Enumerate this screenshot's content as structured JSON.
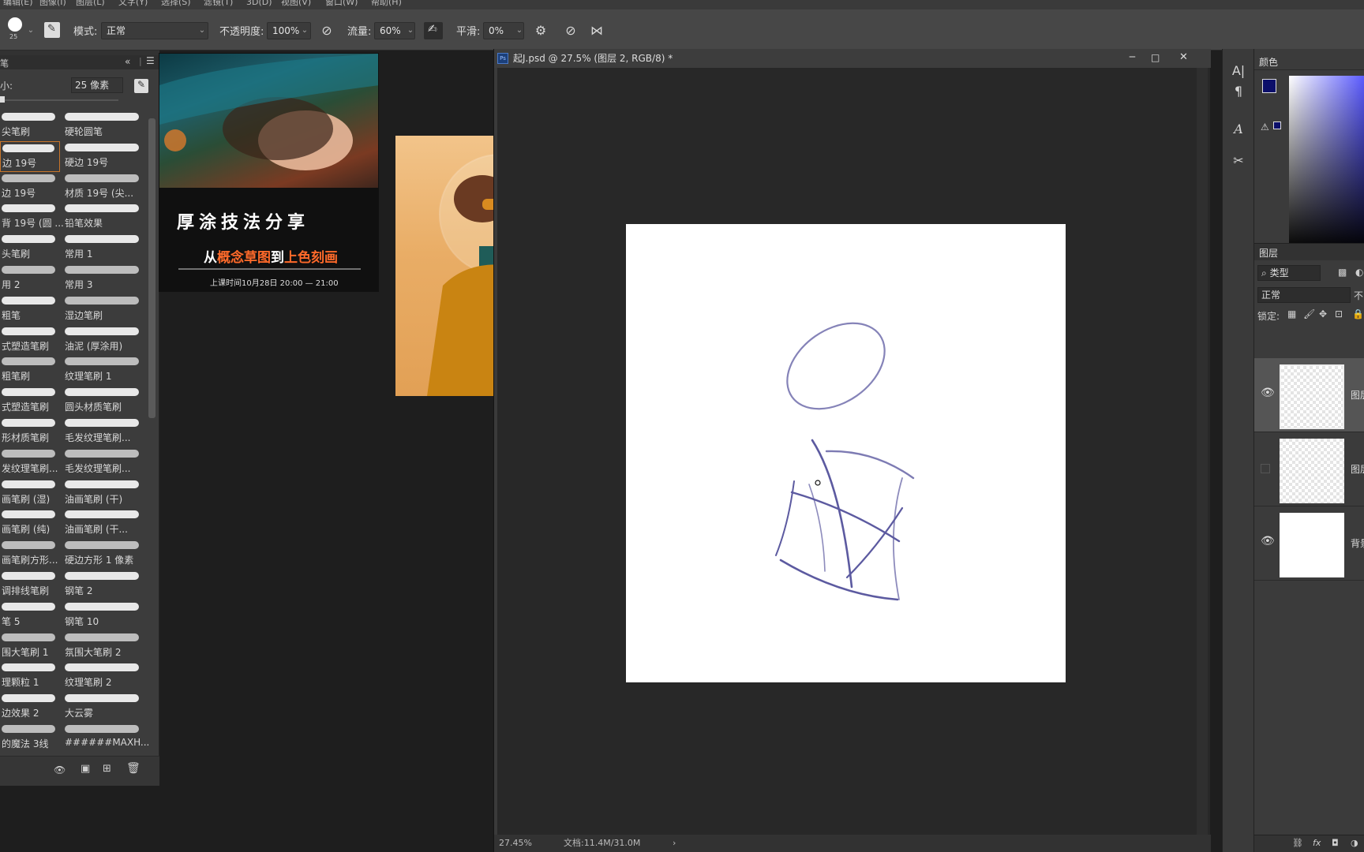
{
  "menu": [
    "编辑(E)",
    "图像(I)",
    "图层(L)",
    "文字(Y)",
    "选择(S)",
    "滤镜(T)",
    "3D(D)",
    "视图(V)",
    "窗口(W)",
    "帮助(H)"
  ],
  "options": {
    "brush_size": "25",
    "mode_label": "模式:",
    "mode_value": "正常",
    "opacity_label": "不透明度:",
    "opacity_value": "100%",
    "flow_label": "流量:",
    "flow_value": "60%",
    "smooth_label": "平滑:",
    "smooth_value": "0%"
  },
  "brush_panel": {
    "title": "笔",
    "size_label": "小:",
    "size_value": "25 像素",
    "brushes": [
      [
        "尖笔刷",
        "硬轮圆笔"
      ],
      [
        "边 19号",
        "硬边 19号"
      ],
      [
        "边 19号",
        "材质 19号 (尖..."
      ],
      [
        "背 19号 (圆 ...",
        "铅笔效果"
      ],
      [
        "头笔刷",
        "常用 1"
      ],
      [
        "用 2",
        "常用 3"
      ],
      [
        "粗笔",
        "湿边笔刷"
      ],
      [
        "式塑造笔刷",
        "油泥 (厚涂用)"
      ],
      [
        "粗笔刷",
        "纹理笔刷 1"
      ],
      [
        "式塑造笔刷",
        "圆头材质笔刷"
      ],
      [
        "形材质笔刷",
        "毛发纹理笔刷..."
      ],
      [
        "发纹理笔刷...",
        "毛发纹理笔刷..."
      ],
      [
        "画笔刷 (湿)",
        "油画笔刷 (干)"
      ],
      [
        "画笔刷 (纯)",
        "油画笔刷 (干..."
      ],
      [
        "画笔刷方形...",
        "硬边方形 1 像素"
      ],
      [
        "调排线笔刷",
        "钢笔 2"
      ],
      [
        "笔 5",
        "钢笔 10"
      ],
      [
        "围大笔刷 1",
        "氛围大笔刷 2"
      ],
      [
        "理颗粒 1",
        "纹理笔刷 2"
      ],
      [
        "边效果 2",
        "大云雾"
      ],
      [
        "的魔法 3线",
        "######MAXH..."
      ]
    ]
  },
  "poster1": {
    "title": "厚涂技法分享",
    "sub_a": "从",
    "sub_b": "概念草图",
    "sub_c": "到",
    "sub_d": "上色刻画",
    "date": "上课时间10月28日   20:00 — 21:00"
  },
  "document": {
    "tab_title": "起J.psd @ 27.5% (图层 2, RGB/8) *",
    "zoom": "27.45%",
    "doc_info": "文档:11.4M/31.0M"
  },
  "right_panel": {
    "color_tab": "颜色",
    "layers_tab": "图层",
    "filter_label": "类型",
    "blend_mode": "正常",
    "opacity_short": "不",
    "lock_label": "锁定:",
    "layers": [
      {
        "name": "图层",
        "visible": true,
        "selected": true
      },
      {
        "name": "图层",
        "visible": false,
        "selected": false
      },
      {
        "name": "背景",
        "visible": true,
        "selected": false
      }
    ],
    "fg_color": "#0c0f6a",
    "accent": "#5a5aff"
  }
}
